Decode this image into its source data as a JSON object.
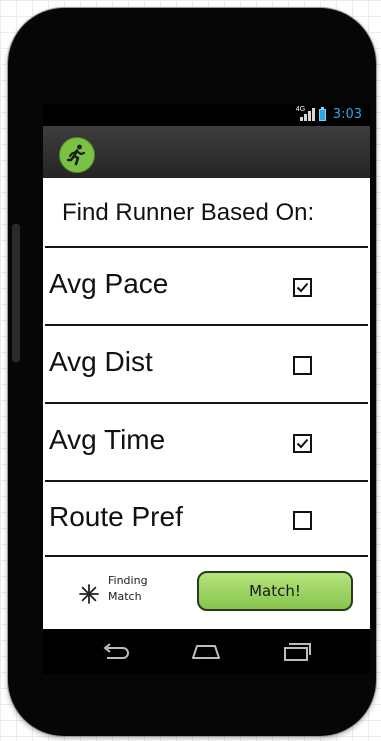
{
  "status_bar": {
    "network_label": "4G",
    "time": "3:03",
    "accent_color": "#29a7e6"
  },
  "app_bar": {
    "logo_icon": "running-man-icon",
    "logo_color": "#7bc244"
  },
  "header": {
    "title": "Find Runner Based On:"
  },
  "criteria": [
    {
      "label": "Avg Pace",
      "checked": true
    },
    {
      "label": "Avg Dist",
      "checked": false
    },
    {
      "label": "Avg Time",
      "checked": true
    },
    {
      "label": "Route Pref",
      "checked": false
    }
  ],
  "footer": {
    "status_line1": "Finding",
    "status_line2": "Match",
    "status_icon": "spinner-icon",
    "match_button": "Match!",
    "button_color": "#8fcd56"
  },
  "nav": {
    "back_icon": "back-icon",
    "home_icon": "home-icon",
    "recents_icon": "recents-icon"
  }
}
